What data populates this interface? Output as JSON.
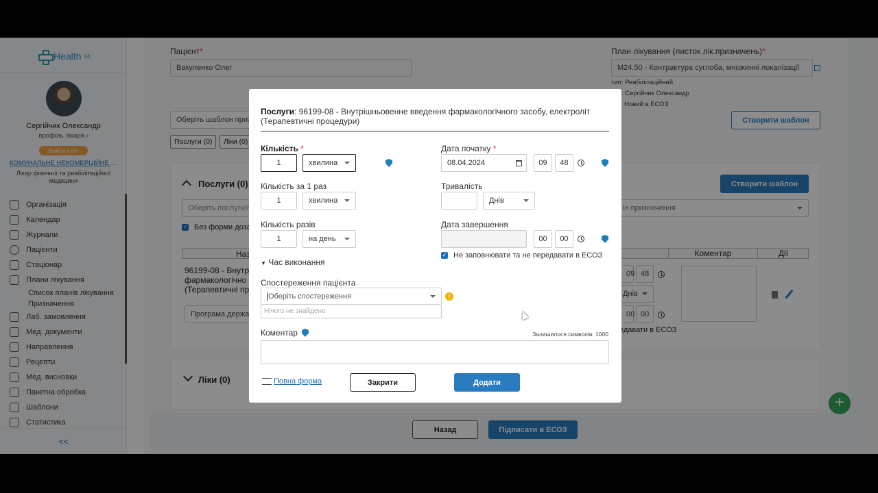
{
  "sidebar": {
    "logo_text": "Health",
    "logo_sup": "24",
    "user_name": "Сергійчик Олександр",
    "profile_link": "профіль лікаря",
    "exit_label": "Вийти з еН",
    "org_name": "КОМУНАЛЬНЕ НЕКОМЕРЦІЙНЕ П...",
    "role": "Лікар фізичної та реабілітаційної медицини",
    "nav": [
      {
        "label": "Організація"
      },
      {
        "label": "Календар"
      },
      {
        "label": "Журнали"
      },
      {
        "label": "Пацієнти"
      },
      {
        "label": "Стаціонар"
      },
      {
        "label": "Плани лікування"
      }
    ],
    "nav_sub": [
      "Список планів лікування",
      "Призначення"
    ],
    "nav2": [
      {
        "label": "Лаб. замовлення"
      },
      {
        "label": "Мед. документи"
      },
      {
        "label": "Направлення"
      },
      {
        "label": "Рецепти"
      },
      {
        "label": "Мед. висновки"
      },
      {
        "label": "Пакетна обробка"
      },
      {
        "label": "Шаблони"
      },
      {
        "label": "Статистика"
      }
    ],
    "collapse_label": "<<"
  },
  "page": {
    "patient_label": "Пацієнт",
    "patient_value": "Вакуленко Олег",
    "plan_label": "План лікування (листок лік.призначень)",
    "plan_value": "M24.50 - Контрактура суглоба, множинні локалізації",
    "type_line": "тип: Реабілітаційний",
    "author_line": "тор: Сергійчик Олександр",
    "status_line": "тус: Новий в ЕСОЗ",
    "template_placeholder": "Оберіть шаблон призн",
    "create_template": "Створити шаблон",
    "tag_services": "Послуги (0)",
    "tag_meds": "Ліки (0)",
    "services_title": "Послуги (0)",
    "services_placeholder": "Оберіть послуги/г",
    "create_template2": "Створити шаблон",
    "purpose_placeholder": "ін призначення",
    "no_form": "Без форми дозав",
    "col_name": "Наз",
    "col_comment": "Коментар",
    "col_actions": "Дії",
    "row_name": "96199-08 - Внутр фармакологічно (Терапевтичні пр",
    "program_placeholder": "Програма держав",
    "row_h1": "09",
    "row_m1": "48",
    "row_days": "Днів",
    "row_h2": "00",
    "row_m2": "00",
    "row_noesoz": "едавати в ЕСОЗ",
    "meds_title": "Ліки (0)",
    "back_label": "Назад",
    "sign_label": "Підписати в ЕСОЗ"
  },
  "modal": {
    "title_bold": "Послуги",
    "title_text": ": 96199-08 - Внутрішньовенне введення фармакологічного засобу, електроліт (Терапевтичні процедури)",
    "qty_label": "Кількість",
    "qty_value": "1",
    "qty_unit": "хвилина",
    "qty_once_label": "Кількість за 1 раз",
    "qty_once_value": "1",
    "qty_once_unit": "хвилина",
    "times_label": "Кількість разів",
    "times_value": "1",
    "times_unit": "на день",
    "exec_time": "Час виконання",
    "start_label": "Дата початку",
    "start_date": "08.04.2024",
    "start_h": "09",
    "start_m": "48",
    "duration_label": "Тривалість",
    "duration_unit": "Днів",
    "end_label": "Дата завершення",
    "end_h": "00",
    "end_m": "00",
    "no_esoz": "Не заповнювати та не передавати в ЕСОЗ",
    "observe_label": "Спостереження пацієнта",
    "observe_placeholder": "Оберіть спостереження",
    "not_found": "Нічого не знайдено",
    "comment_label": "Коментар",
    "chars_left": "Залишилося символів: 1000",
    "full_form": "Повна форма",
    "close_label": "Закрити",
    "add_label": "Додати"
  }
}
